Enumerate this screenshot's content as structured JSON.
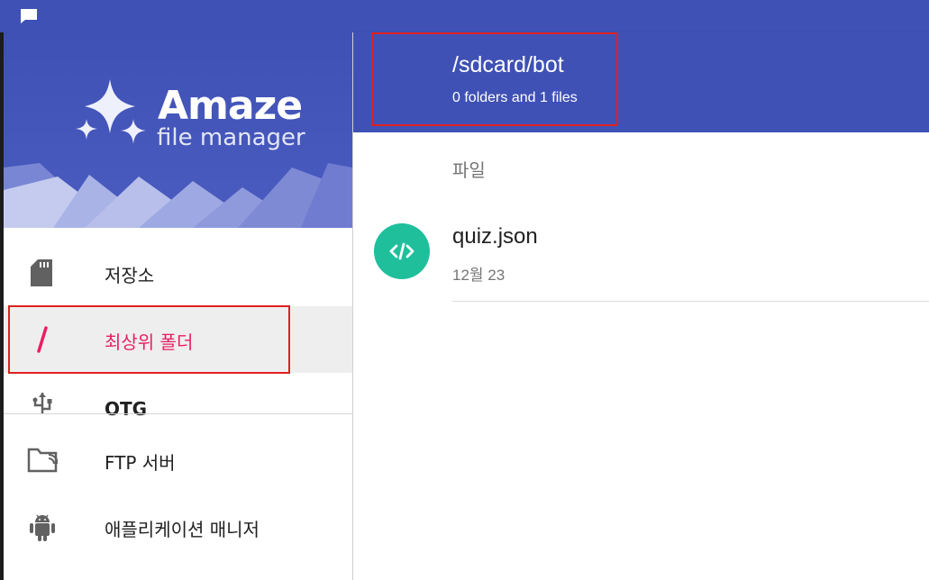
{
  "toolbar": {
    "path": "/sdcard/bot",
    "summary": "0 folders and 1 files"
  },
  "content": {
    "section_header": "파일",
    "files": [
      {
        "name": "quiz.json",
        "date": "12월 23",
        "icon": "code-icon"
      }
    ]
  },
  "drawer": {
    "logo_title": "Amaze",
    "logo_subtitle": "file manager",
    "items": [
      {
        "label": "저장소",
        "icon": "sd-card-icon"
      },
      {
        "label": "최상위 폴더",
        "icon": "slash-icon",
        "active": true
      },
      {
        "label": "OTG",
        "icon": "usb-icon"
      },
      {
        "label": "FTP 서버",
        "icon": "ftp-folder-icon"
      },
      {
        "label": "애플리케이션 매니저",
        "icon": "android-icon"
      }
    ]
  },
  "colors": {
    "primary": "#3f51b5",
    "accent": "#e91e63",
    "file_icon": "#1fbf9c"
  }
}
